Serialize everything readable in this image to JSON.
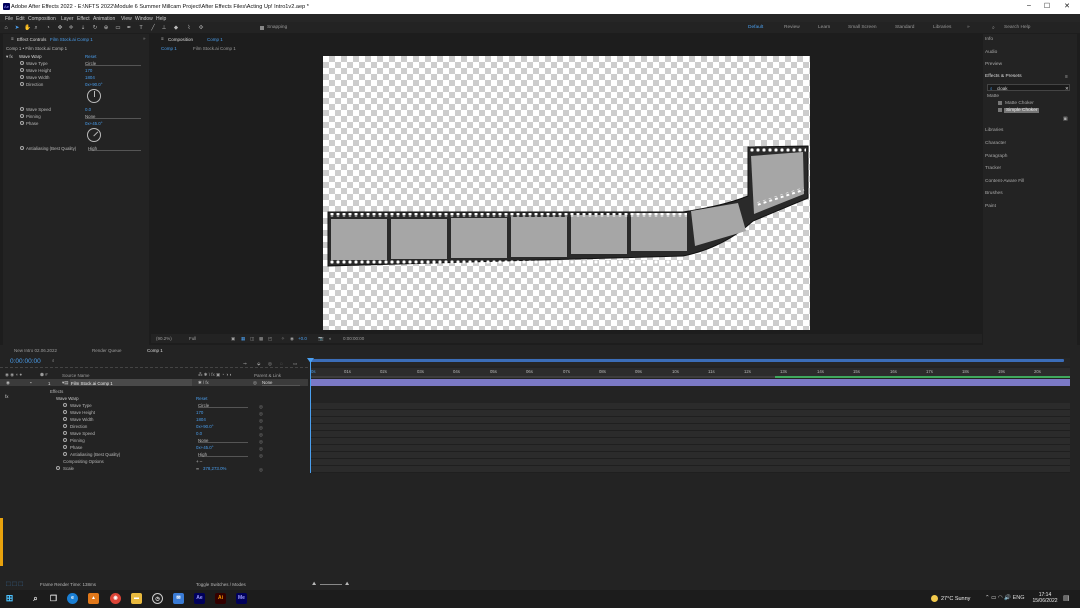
{
  "window": {
    "title": "Adobe After Effects 2022 - E:\\NFTS 2022\\Module 6 Summer Millcam Project\\After Effects Files\\Acting Up! Intro1v2.aep *",
    "app_icon": "Ae"
  },
  "menu": [
    "File",
    "Edit",
    "Composition",
    "Layer",
    "Effect",
    "Animation",
    "View",
    "Window",
    "Help"
  ],
  "toolbar": {
    "snapping": "Snapping",
    "workspaces": [
      "Default",
      "Review",
      "Learn",
      "Small Screen",
      "Standard",
      "Libraries"
    ],
    "search_placeholder": "Search Help"
  },
  "effect_controls": {
    "tab": "Effect Controls",
    "tab_layer": "Film Stock.ai Comp 1",
    "breadcrumb": "Comp 1 • Film Stock.ai Comp 1",
    "effect_name": "Wave Warp",
    "reset": "Reset",
    "properties": [
      {
        "label": "Wave Type",
        "value": "Circle",
        "kind": "dropdown"
      },
      {
        "label": "Wave Height",
        "value": "170",
        "kind": "number"
      },
      {
        "label": "Wave Width",
        "value": "1804",
        "kind": "number"
      },
      {
        "label": "Direction",
        "value": "0x+90.0°",
        "kind": "number"
      },
      {
        "label": "Wave Speed",
        "value": "0.0",
        "kind": "number"
      },
      {
        "label": "Pinning",
        "value": "None",
        "kind": "dropdown"
      },
      {
        "label": "Phase",
        "value": "0x+45.0°",
        "kind": "number"
      },
      {
        "label": "Antialiasing (Best Quality)",
        "value": "High",
        "kind": "dropdown"
      }
    ]
  },
  "composition": {
    "tab": "Composition",
    "tab_comp": "Comp 1",
    "sub_tabs": [
      "Comp 1",
      "Film Stock.ai Comp 1"
    ],
    "zoom": "(90.2%)",
    "resolution": "Full",
    "exposure": "+0.0",
    "timecode": "0:00:00:00"
  },
  "right_panels": [
    "Info",
    "Audio",
    "Preview",
    "Effects & Presets",
    "Libraries",
    "Character",
    "Paragraph",
    "Tracker",
    "Content-Aware Fill",
    "Brushes",
    "Paint"
  ],
  "effects_presets": {
    "search": "cloak",
    "category": "Matte",
    "items": [
      "Matte Choker",
      "Simple Choker"
    ]
  },
  "timeline": {
    "tabs": [
      "New Intro 02.06.2022",
      "Render Queue",
      "Comp 1"
    ],
    "timecode": "0:00:00:00",
    "columns": {
      "source": "Source Name",
      "parent": "Parent & Link"
    },
    "layer": {
      "index": "1",
      "name": "Film Stock.ai Comp 1",
      "parent": "None"
    },
    "tree": {
      "effects": "Effects",
      "wave_warp": "Wave Warp",
      "reset": "Reset",
      "compositing": "Compositing Options",
      "scale": "Scale",
      "scale_value": "378,273.0%"
    },
    "ruler": [
      "0s",
      "01s",
      "02s",
      "03s",
      "04s",
      "05s",
      "06s",
      "07s",
      "08s",
      "09s",
      "10s",
      "11s",
      "12s",
      "13s",
      "14s",
      "15s",
      "16s",
      "17s",
      "18s",
      "19s",
      "20s"
    ],
    "footer_render": "Frame Render Time: 138ms",
    "footer_toggle": "Toggle Switches / Modes"
  },
  "taskbar": {
    "weather": "27°C Sunny",
    "time": "17:14",
    "date": "15/06/2022"
  },
  "colors": {
    "accent": "#4a9fef",
    "layer_bar": "#7b79c5",
    "work_area": "#3fa85d"
  }
}
